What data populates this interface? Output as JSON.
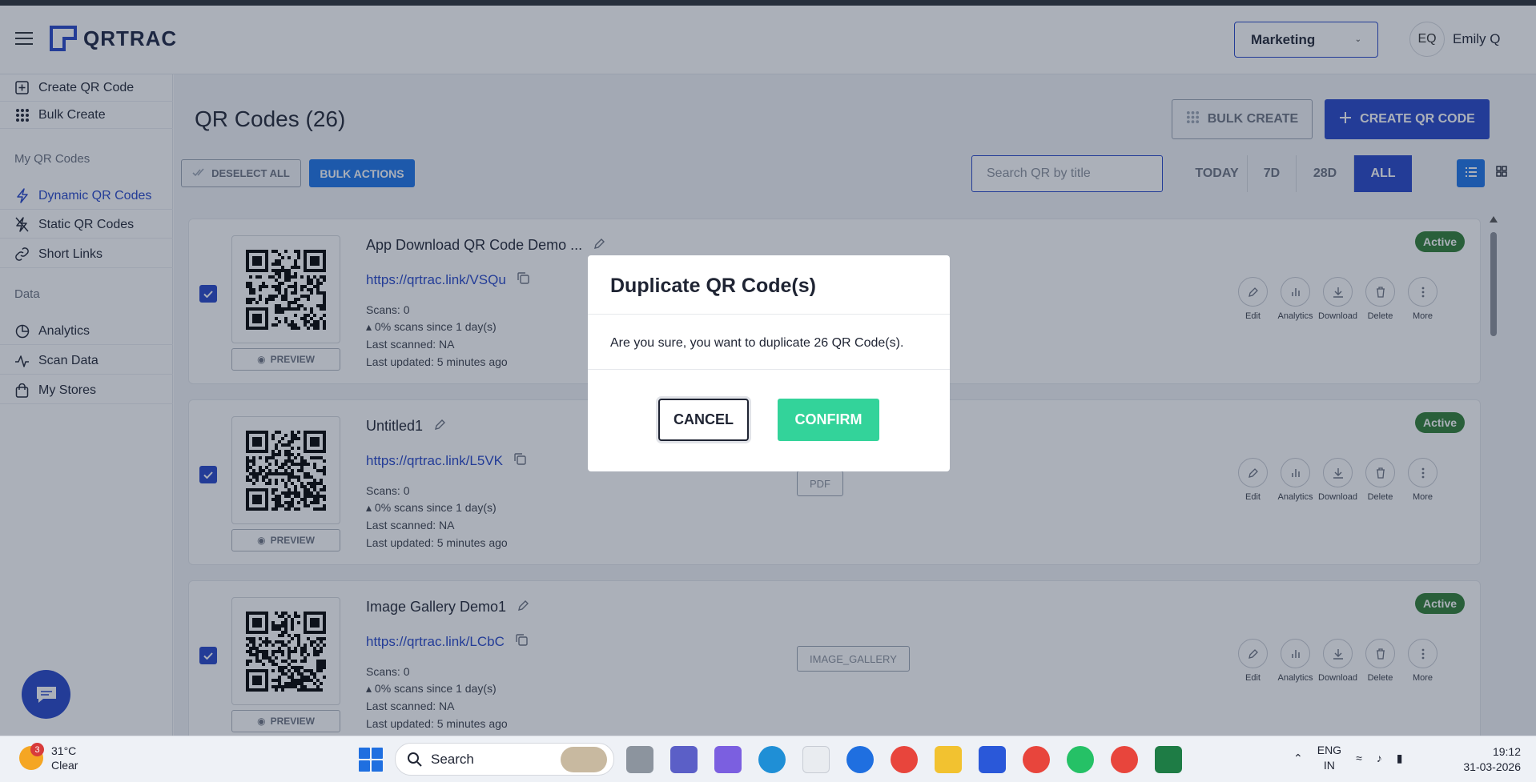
{
  "header": {
    "app_name": "QRTRAC",
    "workspace": "Marketing",
    "user_initials": "EQ",
    "user_name": "Emily Q"
  },
  "sidebar": {
    "create_qr": "Create QR Code",
    "bulk_create": "Bulk Create",
    "section_my_qr": "My QR Codes",
    "dynamic": "Dynamic QR Codes",
    "static": "Static QR Codes",
    "short_links": "Short Links",
    "section_data": "Data",
    "analytics": "Analytics",
    "scan_data": "Scan Data",
    "my_stores": "My Stores"
  },
  "main": {
    "title": "QR Codes (26)",
    "bulk_create_label": "BULK CREATE",
    "create_label": "CREATE QR CODE",
    "deselect_label": "DESELECT ALL",
    "bulk_actions_label": "BULK ACTIONS",
    "search_placeholder": "Search QR by title",
    "ranges": [
      "TODAY",
      "7D",
      "28D",
      "ALL"
    ],
    "active_range": "ALL"
  },
  "cards": [
    {
      "title": "App Download QR Code Demo ...",
      "link": "https://qrtrac.link/VSQu",
      "scans": "Scans: 0",
      "trend": "0% scans since 1 day(s)",
      "last_scanned": "Last scanned: NA",
      "last_updated": "Last updated: 5 minutes ago",
      "type": "",
      "status": "Active",
      "preview": "PREVIEW",
      "checked": true
    },
    {
      "title": "Untitled1",
      "link": "https://qrtrac.link/L5VK",
      "scans": "Scans: 0",
      "trend": "0% scans since 1 day(s)",
      "last_scanned": "Last scanned: NA",
      "last_updated": "Last updated: 5 minutes ago",
      "type": "PDF",
      "status": "Active",
      "preview": "PREVIEW",
      "checked": true
    },
    {
      "title": "Image Gallery Demo1",
      "link": "https://qrtrac.link/LCbC",
      "scans": "Scans: 0",
      "trend": "0% scans since 1 day(s)",
      "last_scanned": "Last scanned: NA",
      "last_updated": "Last updated: 5 minutes ago",
      "type": "IMAGE_GALLERY",
      "status": "Active",
      "preview": "PREVIEW",
      "checked": true
    }
  ],
  "card_actions": [
    "Edit",
    "Analytics",
    "Download",
    "Delete",
    "More"
  ],
  "modal": {
    "title": "Duplicate QR Code(s)",
    "body": "Are you sure, you want to duplicate 26 QR Code(s).",
    "cancel": "CANCEL",
    "confirm": "CONFIRM"
  },
  "taskbar": {
    "notification_count": "3",
    "temperature": "31°C",
    "condition": "Clear",
    "search_label": "Search",
    "lang_top": "ENG",
    "lang_bottom": "IN",
    "time": "19:12",
    "date": "31-03-2026"
  },
  "colors": {
    "brand": "#2545c9",
    "active_badge": "#2e7d32",
    "confirm": "#33d39a"
  }
}
